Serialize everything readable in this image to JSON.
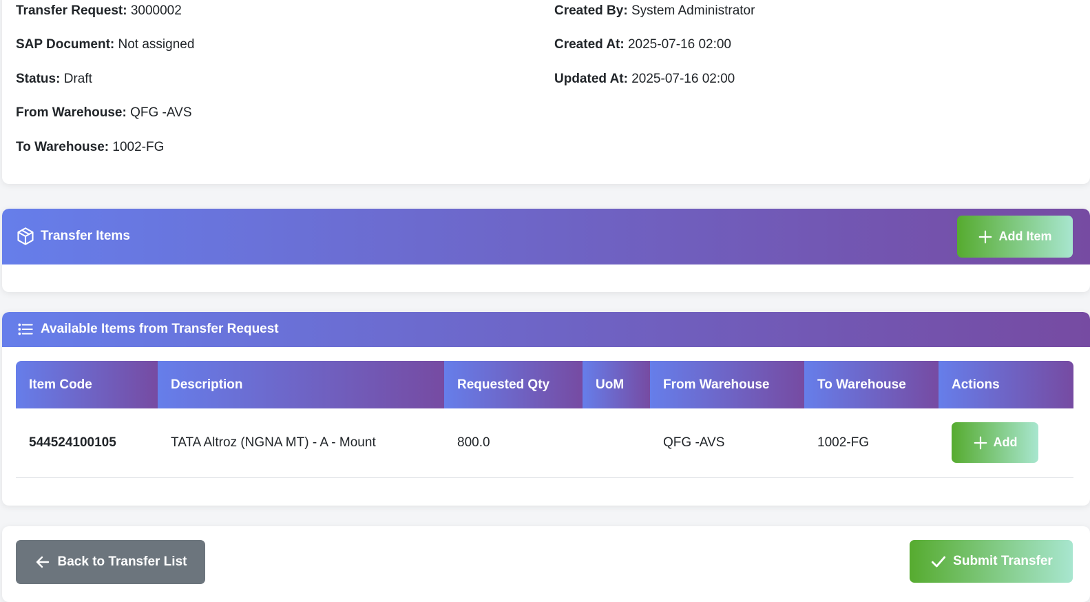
{
  "info": {
    "left": [
      {
        "label": "Transfer Request:",
        "value": "3000002"
      },
      {
        "label": "SAP Document:",
        "value": "Not assigned"
      },
      {
        "label": "Status:",
        "value": "Draft"
      },
      {
        "label": "From Warehouse:",
        "value": "QFG -AVS"
      },
      {
        "label": "To Warehouse:",
        "value": "1002-FG"
      }
    ],
    "right": [
      {
        "label": "Created By:",
        "value": "System Administrator"
      },
      {
        "label": "Created At:",
        "value": "2025-07-16 02:00"
      },
      {
        "label": "Updated At:",
        "value": "2025-07-16 02:00"
      }
    ]
  },
  "transfer_items": {
    "title": "Transfer Items",
    "icon": "box-icon",
    "add_item_label": "Add Item"
  },
  "available_items": {
    "title": "Available Items from Transfer Request",
    "icon": "list-icon",
    "columns": [
      "Item Code",
      "Description",
      "Requested Qty",
      "UoM",
      "From Warehouse",
      "To Warehouse",
      "Actions"
    ],
    "rows": [
      {
        "item_code": "544524100105",
        "description": "TATA Altroz (NGNA MT) - A - Mount",
        "requested_qty": "800.0",
        "uom": "",
        "from_warehouse": "QFG -AVS",
        "to_warehouse": "1002-FG",
        "action_label": "Add"
      }
    ]
  },
  "footer": {
    "back_label": "Back to Transfer List",
    "submit_label": "Submit Transfer"
  },
  "colors": {
    "header_gradient_start": "#667eea",
    "header_gradient_end": "#764ba2",
    "success_start": "#56ab2f",
    "success_end": "#a8e6cf",
    "secondary": "#6c757d"
  }
}
